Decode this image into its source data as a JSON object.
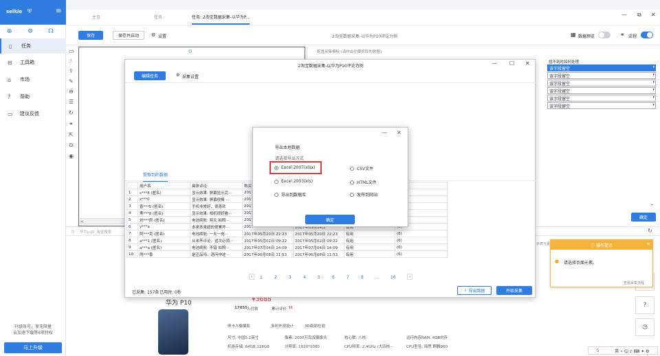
{
  "sidebar": {
    "username": "selkie",
    "items": [
      {
        "label": "任务",
        "icon": "doc-icon",
        "active": true
      },
      {
        "label": "工具箱",
        "icon": "toolbox-icon"
      },
      {
        "label": "市场",
        "icon": "bag-icon"
      },
      {
        "label": "帮助",
        "icon": "help-icon"
      },
      {
        "label": "建议反馈",
        "icon": "feedback-icon"
      }
    ],
    "upgrade_text_1": "升级账号，享无限量",
    "upgrade_text_2": "云加速下载等8项特权",
    "upgrade_button": "马上升级"
  },
  "tabs": [
    "主页",
    "任务",
    "任务: 2淘宝数据采集-以华为P..."
  ],
  "toolbar": {
    "save": "保存",
    "save_start": "保存并启动",
    "settings": "设置",
    "task_title": "2淘宝数据采集-以华为P10评论为例",
    "data_preview": "数据预览",
    "flow": "流程"
  },
  "right_panel": {
    "hint": "配置采集模板 (请作由你要抓取的数据)",
    "header": "找不到时如何处理",
    "rows": [
      "该字段留空",
      "该字段留空",
      "该字段留空",
      "该字段留空",
      "该字段留空",
      "该字段留空"
    ],
    "confirm": "确定"
  },
  "url_placeholder": "华为p10_淘宝搜索",
  "dialog1": {
    "title": "2淘宝数据采集-以华为P10评论为例",
    "edit_task": "编辑任务",
    "collect_settings": "采集设置",
    "data_tab": "提取到的数据",
    "columns": [
      "",
      "用户名",
      "具体评论",
      "购买",
      "",
      "",
      "数"
    ],
    "rows": [
      [
        "1",
        "s***8 (匿名)",
        "显示效果: 屏幕显示完···",
        "2017",
        "",
        "",
        ""
      ],
      [
        "2",
        "z***0",
        "显示效果: 屏幕很棒 ···",
        "2017",
        "",
        "",
        ""
      ],
      [
        "3",
        "香***5 (匿名)",
        "手机非常好，很喜欢",
        "2017",
        "",
        "",
        ""
      ],
      [
        "4",
        "黑***8 (匿名)",
        "显示效果: 相机很好看···",
        "2017",
        "",
        "",
        ""
      ],
      [
        "5",
        "刘***房 (匿名)",
        "电池续航: 两天 拍照···",
        "2017",
        "",
        "",
        ""
      ],
      [
        "6",
        "y***a",
        "本来本来超的很累坏···",
        "2017",
        "2017年05月14日",
        "有用",
        "(6)"
      ],
      [
        "7",
        "阿***克 (匿名)",
        "电池续航: 一天一充···",
        "2017年05月20日 22:23",
        "2017年05月20日 22:23",
        "有用",
        "(6)"
      ],
      [
        "8",
        "a***1 (匿名)",
        "从未不评论，这次必须···",
        "2017年05月02日 09:22",
        "2017年05月02日 09:22",
        "有用",
        "(6)"
      ],
      [
        "9",
        "a***a (匿名)",
        "电池续航: 不错 拍照···",
        "2017年07月04日 14:09",
        "2017年07月04日 14:09",
        "有用",
        "(6)"
      ],
      [
        "10",
        "两***香",
        "是正品吗，语问中途···",
        "2017年06月08日 11:53",
        "2017年06月08日 11:53",
        "有用",
        "(6)"
      ]
    ],
    "pages": [
      "1",
      "2",
      "3",
      "4",
      "5",
      "6",
      "7",
      "8",
      "...",
      "16"
    ],
    "collected": "已采集: 157条",
    "elapsed": "已用时: 0秒",
    "export": "导出数据",
    "start": "开始采集"
  },
  "dialog2": {
    "heading": "导出本地数据",
    "subheading": "请选择导出方式",
    "options": [
      {
        "label": "Excel 2007(xlsx)",
        "selected": true
      },
      {
        "label": "CSV文件"
      },
      {
        "label": "Excel 2003(xls)"
      },
      {
        "label": "HTML文件"
      },
      {
        "label": "导出到数据库"
      },
      {
        "label": "发布到网站"
      }
    ],
    "confirm": "确定"
  },
  "notice": {
    "title": "操作提示",
    "message": "请选择页面元素。",
    "link": "查看采集流程"
  },
  "product": {
    "model": "华为 P10",
    "price": "¥3688",
    "sales": "17855",
    "sales_unit": "人付款",
    "reviews_label": "累计评价",
    "reviews": "36",
    "features": [
      "徕卡人像摄影",
      "多彩外观设计",
      "3D面部检测"
    ],
    "specs": [
      "尺寸: 中国5.1英寸",
      "像素: 2000万后双摄像头",
      "核心数: 八核",
      "运行内存RAM: 4GB内存",
      "机身存储: 64GB,128GB",
      "分辨率: 1920*1080",
      "CPU频率: 2.4GHz (大四核···",
      "CPU型号: 海思 麒麟960"
    ]
  },
  "truncated_text": "示表元素"
}
